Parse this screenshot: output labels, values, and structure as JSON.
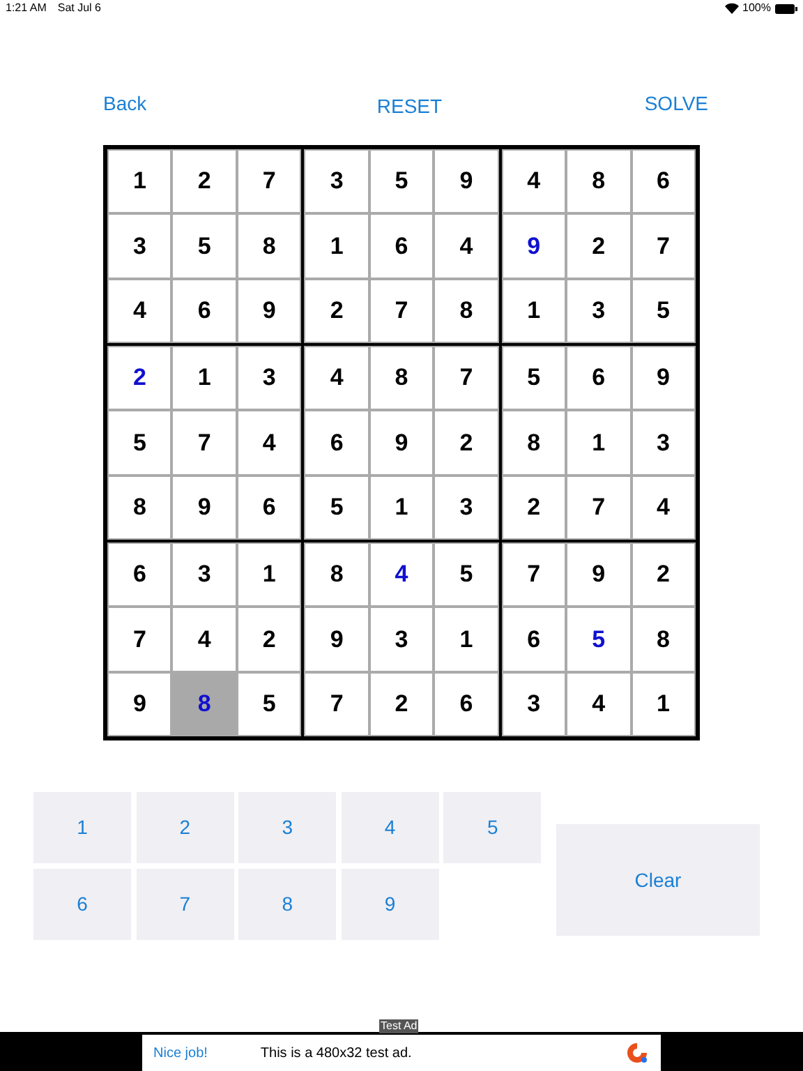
{
  "status_bar": {
    "time": "1:21 AM",
    "date": "Sat Jul 6",
    "battery": "100%"
  },
  "toolbar": {
    "back": "Back",
    "reset": "RESET",
    "solve": "SOLVE"
  },
  "grid": [
    [
      {
        "digit": "1",
        "entered": false,
        "selected": false
      },
      {
        "digit": "2",
        "entered": false,
        "selected": false
      },
      {
        "digit": "7",
        "entered": false,
        "selected": false
      },
      {
        "digit": "3",
        "entered": false,
        "selected": false
      },
      {
        "digit": "5",
        "entered": false,
        "selected": false
      },
      {
        "digit": "9",
        "entered": false,
        "selected": false
      },
      {
        "digit": "4",
        "entered": false,
        "selected": false
      },
      {
        "digit": "8",
        "entered": false,
        "selected": false
      },
      {
        "digit": "6",
        "entered": false,
        "selected": false
      }
    ],
    [
      {
        "digit": "3",
        "entered": false,
        "selected": false
      },
      {
        "digit": "5",
        "entered": false,
        "selected": false
      },
      {
        "digit": "8",
        "entered": false,
        "selected": false
      },
      {
        "digit": "1",
        "entered": false,
        "selected": false
      },
      {
        "digit": "6",
        "entered": false,
        "selected": false
      },
      {
        "digit": "4",
        "entered": false,
        "selected": false
      },
      {
        "digit": "9",
        "entered": true,
        "selected": false
      },
      {
        "digit": "2",
        "entered": false,
        "selected": false
      },
      {
        "digit": "7",
        "entered": false,
        "selected": false
      }
    ],
    [
      {
        "digit": "4",
        "entered": false,
        "selected": false
      },
      {
        "digit": "6",
        "entered": false,
        "selected": false
      },
      {
        "digit": "9",
        "entered": false,
        "selected": false
      },
      {
        "digit": "2",
        "entered": false,
        "selected": false
      },
      {
        "digit": "7",
        "entered": false,
        "selected": false
      },
      {
        "digit": "8",
        "entered": false,
        "selected": false
      },
      {
        "digit": "1",
        "entered": false,
        "selected": false
      },
      {
        "digit": "3",
        "entered": false,
        "selected": false
      },
      {
        "digit": "5",
        "entered": false,
        "selected": false
      }
    ],
    [
      {
        "digit": "2",
        "entered": true,
        "selected": false
      },
      {
        "digit": "1",
        "entered": false,
        "selected": false
      },
      {
        "digit": "3",
        "entered": false,
        "selected": false
      },
      {
        "digit": "4",
        "entered": false,
        "selected": false
      },
      {
        "digit": "8",
        "entered": false,
        "selected": false
      },
      {
        "digit": "7",
        "entered": false,
        "selected": false
      },
      {
        "digit": "5",
        "entered": false,
        "selected": false
      },
      {
        "digit": "6",
        "entered": false,
        "selected": false
      },
      {
        "digit": "9",
        "entered": false,
        "selected": false
      }
    ],
    [
      {
        "digit": "5",
        "entered": false,
        "selected": false
      },
      {
        "digit": "7",
        "entered": false,
        "selected": false
      },
      {
        "digit": "4",
        "entered": false,
        "selected": false
      },
      {
        "digit": "6",
        "entered": false,
        "selected": false
      },
      {
        "digit": "9",
        "entered": false,
        "selected": false
      },
      {
        "digit": "2",
        "entered": false,
        "selected": false
      },
      {
        "digit": "8",
        "entered": false,
        "selected": false
      },
      {
        "digit": "1",
        "entered": false,
        "selected": false
      },
      {
        "digit": "3",
        "entered": false,
        "selected": false
      }
    ],
    [
      {
        "digit": "8",
        "entered": false,
        "selected": false
      },
      {
        "digit": "9",
        "entered": false,
        "selected": false
      },
      {
        "digit": "6",
        "entered": false,
        "selected": false
      },
      {
        "digit": "5",
        "entered": false,
        "selected": false
      },
      {
        "digit": "1",
        "entered": false,
        "selected": false
      },
      {
        "digit": "3",
        "entered": false,
        "selected": false
      },
      {
        "digit": "2",
        "entered": false,
        "selected": false
      },
      {
        "digit": "7",
        "entered": false,
        "selected": false
      },
      {
        "digit": "4",
        "entered": false,
        "selected": false
      }
    ],
    [
      {
        "digit": "6",
        "entered": false,
        "selected": false
      },
      {
        "digit": "3",
        "entered": false,
        "selected": false
      },
      {
        "digit": "1",
        "entered": false,
        "selected": false
      },
      {
        "digit": "8",
        "entered": false,
        "selected": false
      },
      {
        "digit": "4",
        "entered": true,
        "selected": false
      },
      {
        "digit": "5",
        "entered": false,
        "selected": false
      },
      {
        "digit": "7",
        "entered": false,
        "selected": false
      },
      {
        "digit": "9",
        "entered": false,
        "selected": false
      },
      {
        "digit": "2",
        "entered": false,
        "selected": false
      }
    ],
    [
      {
        "digit": "7",
        "entered": false,
        "selected": false
      },
      {
        "digit": "4",
        "entered": false,
        "selected": false
      },
      {
        "digit": "2",
        "entered": false,
        "selected": false
      },
      {
        "digit": "9",
        "entered": false,
        "selected": false
      },
      {
        "digit": "3",
        "entered": false,
        "selected": false
      },
      {
        "digit": "1",
        "entered": false,
        "selected": false
      },
      {
        "digit": "6",
        "entered": false,
        "selected": false
      },
      {
        "digit": "5",
        "entered": true,
        "selected": false
      },
      {
        "digit": "8",
        "entered": false,
        "selected": false
      }
    ],
    [
      {
        "digit": "9",
        "entered": false,
        "selected": false
      },
      {
        "digit": "8",
        "entered": true,
        "selected": true
      },
      {
        "digit": "5",
        "entered": false,
        "selected": false
      },
      {
        "digit": "7",
        "entered": false,
        "selected": false
      },
      {
        "digit": "2",
        "entered": false,
        "selected": false
      },
      {
        "digit": "6",
        "entered": false,
        "selected": false
      },
      {
        "digit": "3",
        "entered": false,
        "selected": false
      },
      {
        "digit": "4",
        "entered": false,
        "selected": false
      },
      {
        "digit": "1",
        "entered": false,
        "selected": false
      }
    ]
  ],
  "keypad": [
    "1",
    "2",
    "3",
    "4",
    "5",
    "6",
    "7",
    "8",
    "9"
  ],
  "clear": "Clear",
  "ad": {
    "label": "Test Ad",
    "headline": "Nice job!",
    "text": "This is a 480x32 test ad."
  }
}
